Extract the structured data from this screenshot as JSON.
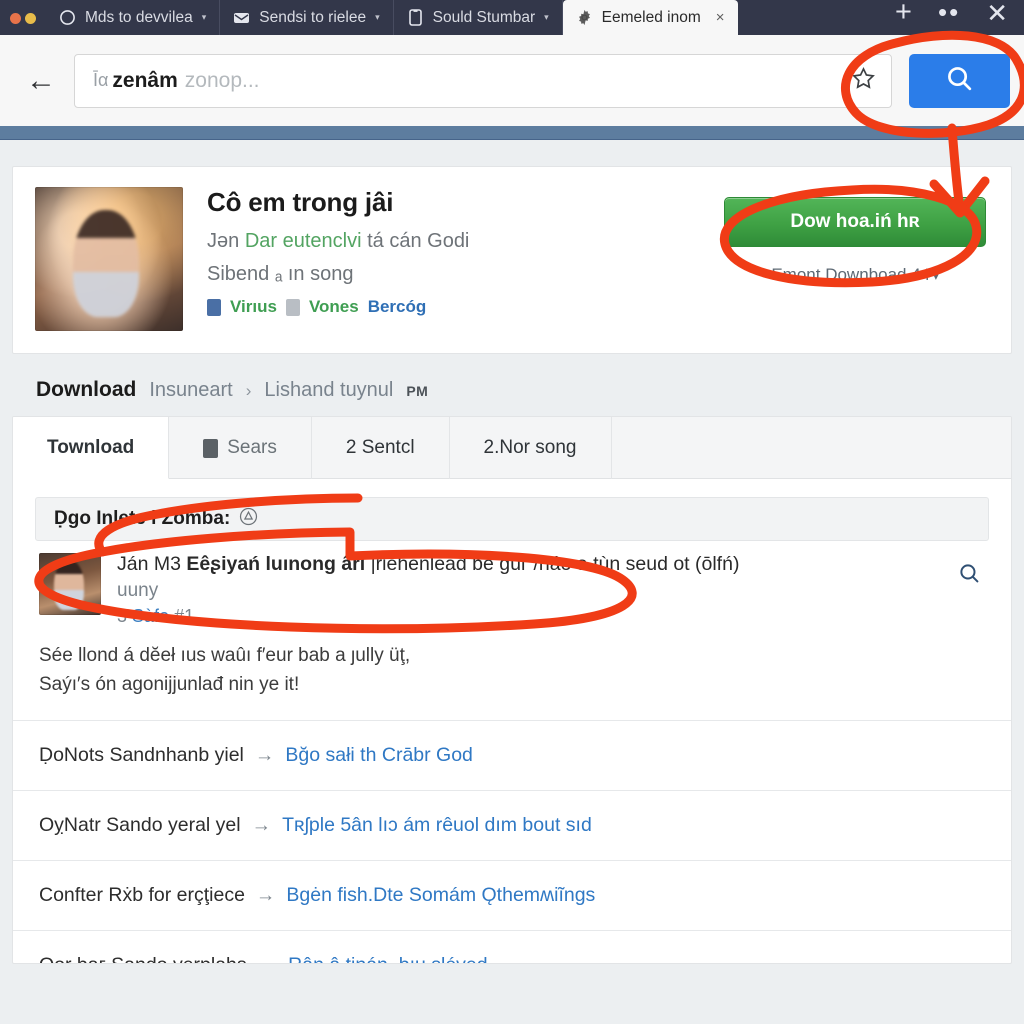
{
  "browser": {
    "tabs": [
      {
        "label": "Mds to devvilea",
        "icon": "circle-icon",
        "caret": "▾",
        "active": false
      },
      {
        "label": "Sendsi to rielee",
        "icon": "mail-icon",
        "caret": "▾",
        "active": false
      },
      {
        "label": "Sould Stumbar",
        "icon": "book-icon",
        "caret": "▾",
        "active": false
      },
      {
        "label": "Eemeled inom",
        "icon": "gear-icon",
        "caret": "",
        "active": true,
        "close": "×"
      }
    ],
    "new_tab": "+",
    "overflow": "••",
    "window_close": "✕",
    "back_arrow": "←",
    "omnibox": {
      "prefix": "Īα",
      "value": "zenâm",
      "placeholder": "zonop...",
      "star_icon": "star-icon"
    },
    "search_button": {
      "icon": "search-icon",
      "color": "#2b7de9"
    }
  },
  "hero": {
    "thumb_alt": "portrait-thumbnail",
    "title": "Cô em trong jâi",
    "subtitle_pre": "Jǝn",
    "subtitle_green": "Dar eutenclvi",
    "subtitle_post": "tá cán Godi",
    "subtitle2": "Sibend ₐ ın song",
    "badge1": "Virıus",
    "badge2": "Vones",
    "badge3": "Bercóg",
    "download_label": "Dow hoa.iń hʀ",
    "download_color": "#3fa144",
    "download_sub": "Emonţ Downboad 44",
    "download_sub_caret": "▾"
  },
  "breadcrumb": {
    "primary": "Download",
    "second": "Insuneart",
    "separator": "›",
    "third": "Lishand tuуnul",
    "suffix": "PM"
  },
  "panel": {
    "tabs": [
      {
        "label": "Townload",
        "active": true,
        "icon": ""
      },
      {
        "label": "Sears",
        "active": false,
        "icon": "battery-icon"
      },
      {
        "label": "2 Sentcl",
        "active": false,
        "icon": ""
      },
      {
        "label": "2.Nor song",
        "active": false,
        "icon": ""
      }
    ],
    "grey_bar": {
      "text": "Ḍgo Inlete i Zomba:",
      "icon": "alert-triangle-icon"
    },
    "result": {
      "thumb_alt": "result-thumbnail",
      "line1_pre": "Ján M3 ",
      "line1_bold": "Еêʂiyań luınong ârı",
      "line1_post": " |riehenlead bê gûг /náo a tùn seud ot (ōlfń)",
      "line2": "uuny",
      "line3_num": "3",
      "line3_link": "Sàfo",
      "line3_tail": "#1",
      "magnifier": "search-icon"
    },
    "paragraph_line1": "Sée llond á dĕeł ıus waûı f′eur bab a ȷully üţ,",
    "paragraph_line2": "Saýı′s ón agonĳjunlađ nin ye it!",
    "rows": [
      {
        "left": "ḌoNots Sandnhanb yiel",
        "arrow": "→",
        "link": "Bğo sałi th Crābr God"
      },
      {
        "left": "OỵNatr Sando yeral yel",
        "arrow": "→",
        "link": "Tʀʃple 5ân lıɔ ám rêuol dım bout sıd"
      },
      {
        "left": "Confter Rẋb for erçţiece",
        "arrow": "→",
        "link": "Βgėn fish.Dte Somám Ǫthemʍiĩngs"
      },
      {
        "left": "Oǫr baг Sando yerplahs",
        "arrow": "→",
        "link": "Rân â tinán, bıu sléved"
      }
    ]
  },
  "annotations": {
    "color": "#f03c16",
    "marks": [
      "ellipse-around-search-button",
      "arrow-from-search-to-download",
      "ellipse-around-download-button",
      "ellipse-around-result-title"
    ]
  }
}
